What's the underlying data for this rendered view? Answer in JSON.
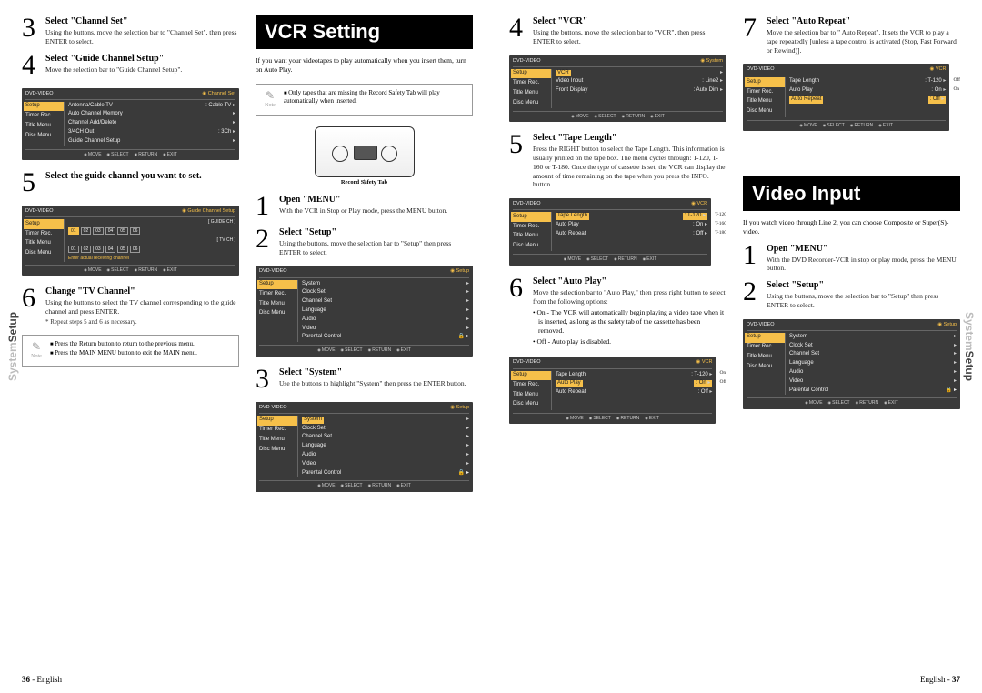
{
  "pageLeft": {
    "sideTab": {
      "light": "System",
      "dark": "Setup"
    },
    "footer": {
      "num": "36",
      "lang": "English"
    },
    "col1": {
      "step3": {
        "title": "Select \"Channel Set\"",
        "desc": "Using the        buttons, move the selection bar to \"Channel Set\", then press ENTER to select."
      },
      "step4": {
        "title": "Select \"Guide Channel Setup\"",
        "desc": "Move the selection bar to \"Guide Channel Setup\"."
      },
      "osd1": {
        "headL": "DVD-VIDEO",
        "headR": "Channel Set",
        "side": [
          "Setup",
          "Timer Rec.",
          "Title Menu",
          "Disc Menu"
        ],
        "rows": [
          [
            "Antenna/Cable TV",
            ": Cable TV"
          ],
          [
            "Auto Channel Memory",
            ""
          ],
          [
            "Channel Add/Delete",
            ""
          ],
          [
            "3/4CH Out",
            ": 3Ch"
          ],
          [
            "Guide Channel Setup",
            ""
          ]
        ],
        "foot": [
          "MOVE",
          "SELECT",
          "RETURN",
          "EXIT"
        ]
      },
      "step5": {
        "title": "Select the guide channel you want to set."
      },
      "osd2": {
        "headL": "DVD-VIDEO",
        "headR": "Guide Channel Setup",
        "side": [
          "Setup",
          "Timer Rec.",
          "Title Menu",
          "Disc Menu"
        ],
        "guideLabel": "[ GUIDE CH ]",
        "guide1": [
          "01",
          "02",
          "03",
          "04",
          "05",
          "06"
        ],
        "tvLabel": "[ TV CH ]",
        "guide2": [
          "01",
          "02",
          "03",
          "04",
          "05",
          "06"
        ],
        "msg": "Enter actual receiving channel",
        "foot": [
          "MOVE",
          "SELECT",
          "RETURN",
          "EXIT"
        ]
      },
      "step6": {
        "title": "Change \"TV Channel\"",
        "desc": "Using the        buttons to select the TV channel corresponding to the guide channel and press ENTER.",
        "sub": "* Repeat steps 5 and 6 as necessary."
      },
      "note": [
        "Press the Return button to return to the previous menu.",
        "Press the MAIN MENU button to exit the MAIN menu."
      ]
    },
    "col2": {
      "sectionTitle": "VCR Setting",
      "intro": "If you want your videotapes to play automatically when you insert them, turn on Auto Play.",
      "note": [
        "Only tapes that are missing the Record Safety Tab will play automatically when inserted."
      ],
      "cassetteLabel": "Record Safety Tab",
      "step1": {
        "title": "Open \"MENU\"",
        "desc": "With the VCR in Stop or Play mode, press the MENU button."
      },
      "step2": {
        "title": "Select \"Setup\"",
        "desc": "Using the        buttons, move the selection bar to \"Setup\" then press ENTER to select."
      },
      "osd3": {
        "headL": "DVD-VIDEO",
        "headR": "Setup",
        "side": [
          "Setup",
          "Timer Rec.",
          "Title Menu",
          "Disc Menu"
        ],
        "rows": [
          [
            "System",
            ""
          ],
          [
            "Clock Set",
            ""
          ],
          [
            "Channel Set",
            ""
          ],
          [
            "Language",
            ""
          ],
          [
            "Audio",
            ""
          ],
          [
            "Video",
            ""
          ],
          [
            "Parental Control",
            ""
          ]
        ],
        "foot": [
          "MOVE",
          "SELECT",
          "RETURN",
          "EXIT"
        ]
      },
      "step3": {
        "title": "Select \"System\"",
        "desc": "Use the        buttons to highlight \"System\" then press the ENTER button."
      },
      "osd4": {
        "headL": "DVD-VIDEO",
        "headR": "Setup",
        "side": [
          "Setup",
          "Timer Rec.",
          "Title Menu",
          "Disc Menu"
        ],
        "rows": [
          [
            "System",
            ""
          ],
          [
            "Clock Set",
            ""
          ],
          [
            "Channel Set",
            ""
          ],
          [
            "Language",
            ""
          ],
          [
            "Audio",
            ""
          ],
          [
            "Video",
            ""
          ],
          [
            "Parental Control",
            ""
          ]
        ],
        "hlRow": 0,
        "foot": [
          "MOVE",
          "SELECT",
          "RETURN",
          "EXIT"
        ]
      }
    }
  },
  "pageRight": {
    "sideTab": {
      "light": "System",
      "dark": "Setup"
    },
    "footer": {
      "lang": "English",
      "num": "37"
    },
    "col1": {
      "step4": {
        "title": "Select \"VCR\"",
        "desc": "Using the        buttons, move the selection bar to \"VCR\", then press ENTER to select."
      },
      "osd5": {
        "headL": "DVD-VIDEO",
        "headR": "System",
        "side": [
          "Setup",
          "Timer Rec.",
          "Title Menu",
          "Disc Menu"
        ],
        "rows": [
          [
            "VCR",
            ""
          ],
          [
            "Video Input",
            ": Line2"
          ],
          [
            "Front Display",
            ": Auto Dim"
          ]
        ],
        "hlRow": 0,
        "foot": [
          "MOVE",
          "SELECT",
          "RETURN",
          "EXIT"
        ]
      },
      "step5": {
        "title": "Select \"Tape Length\"",
        "desc": "Press the RIGHT button to select the Tape Length. This information is usually printed on the tape box. The menu cycles through: T-120, T-160 or T-180. Once the type of cassette is set, the VCR can display the amount of time remaining on the tape when you press the INFO. button."
      },
      "osd6": {
        "headL": "DVD-VIDEO",
        "headR": "VCR",
        "side": [
          "Setup",
          "Timer Rec.",
          "Title Menu",
          "Disc Menu"
        ],
        "rows": [
          [
            "Tape Length",
            ": T-120"
          ],
          [
            "Auto Play",
            ": On"
          ],
          [
            "Auto Repeat",
            ": Off"
          ]
        ],
        "hlRow": 0,
        "sideLabels": [
          "T-120",
          "T-160",
          "T-180"
        ],
        "foot": [
          "MOVE",
          "SELECT",
          "RETURN",
          "EXIT"
        ]
      },
      "step6": {
        "title": "Select \"Auto Play\"",
        "desc": "Move the selection bar to \"Auto Play,\" then press right button to select from the following options:",
        "bullets": [
          "On - The VCR will automatically begin playing a video tape when it is inserted, as long as the safety tab of the cassette has been removed.",
          "Off - Auto play is disabled."
        ]
      },
      "osd7": {
        "headL": "DVD-VIDEO",
        "headR": "VCR",
        "side": [
          "Setup",
          "Timer Rec.",
          "Title Menu",
          "Disc Menu"
        ],
        "rows": [
          [
            "Tape Length",
            ": T-120"
          ],
          [
            "Auto Play",
            ": On"
          ],
          [
            "Auto Repeat",
            ": Off"
          ]
        ],
        "hlRow": 1,
        "sideLabels": [
          "On",
          "Off"
        ],
        "foot": [
          "MOVE",
          "SELECT",
          "RETURN",
          "EXIT"
        ]
      }
    },
    "col2": {
      "step7": {
        "title": "Select \"Auto Repeat\"",
        "desc": "Move the selection bar to \" Auto Repeat\". It sets the VCR to play a tape repeatedly [unless a tape control is activated (Stop, Fast Forward or Rewind)]."
      },
      "osd8": {
        "headL": "DVD-VIDEO",
        "headR": "VCR",
        "side": [
          "Setup",
          "Timer Rec.",
          "Title Menu",
          "Disc Menu"
        ],
        "rows": [
          [
            "Tape Length",
            ": T-120"
          ],
          [
            "Auto Play",
            ": On"
          ],
          [
            "Auto Repeat",
            ": Off"
          ]
        ],
        "hlRow": 2,
        "sideLabels": [
          "Off",
          "On"
        ],
        "foot": [
          "MOVE",
          "SELECT",
          "RETURN",
          "EXIT"
        ]
      },
      "sectionTitle": "Video Input",
      "intro": "If you watch video through Line 2, you can choose Composite or Super(S)-video.",
      "step1": {
        "title": "Open \"MENU\"",
        "desc": "With the DVD Recorder-VCR in stop or play mode, press the MENU button."
      },
      "step2": {
        "title": "Select \"Setup\"",
        "desc": "Using the        buttons, move the selection bar to \"Setup\" then press ENTER to select."
      },
      "osd9": {
        "headL": "DVD-VIDEO",
        "headR": "Setup",
        "side": [
          "Setup",
          "Timer Rec.",
          "Title Menu",
          "Disc Menu"
        ],
        "rows": [
          [
            "System",
            ""
          ],
          [
            "Clock Set",
            ""
          ],
          [
            "Channel Set",
            ""
          ],
          [
            "Language",
            ""
          ],
          [
            "Audio",
            ""
          ],
          [
            "Video",
            ""
          ],
          [
            "Parental Control",
            ""
          ]
        ],
        "foot": [
          "MOVE",
          "SELECT",
          "RETURN",
          "EXIT"
        ]
      }
    }
  }
}
